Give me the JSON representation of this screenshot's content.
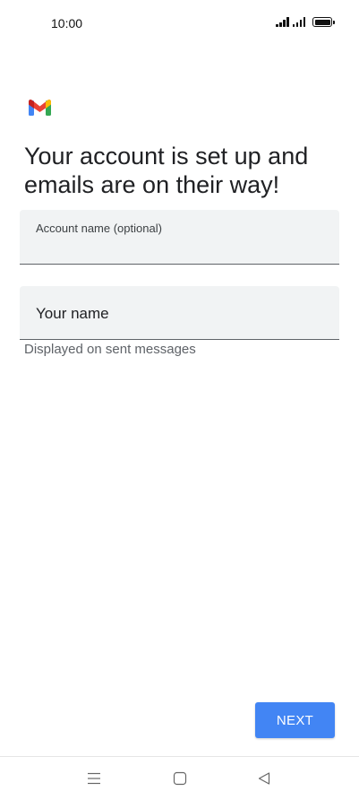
{
  "status_bar": {
    "time": "10:00",
    "icons": [
      "signal-icon",
      "signal-icon",
      "battery-icon"
    ]
  },
  "app": {
    "logo_icon": "gmail-logo-icon",
    "brand_colors": {
      "red": "#ea4335",
      "blue": "#4285f4",
      "green": "#34a853",
      "yellow": "#fbbc04"
    }
  },
  "main": {
    "headline": "Your account is set up and emails are on their way!",
    "account_name_field": {
      "label": "Account name (optional)",
      "value": ""
    },
    "your_name_field": {
      "placeholder": "Your name",
      "value": "",
      "helper_text": "Displayed on sent messages"
    },
    "next_button_label": "NEXT",
    "accent_color": "#4285f4"
  },
  "nav_bar": {
    "icons": [
      "menu-icon",
      "home-icon",
      "back-icon"
    ]
  }
}
